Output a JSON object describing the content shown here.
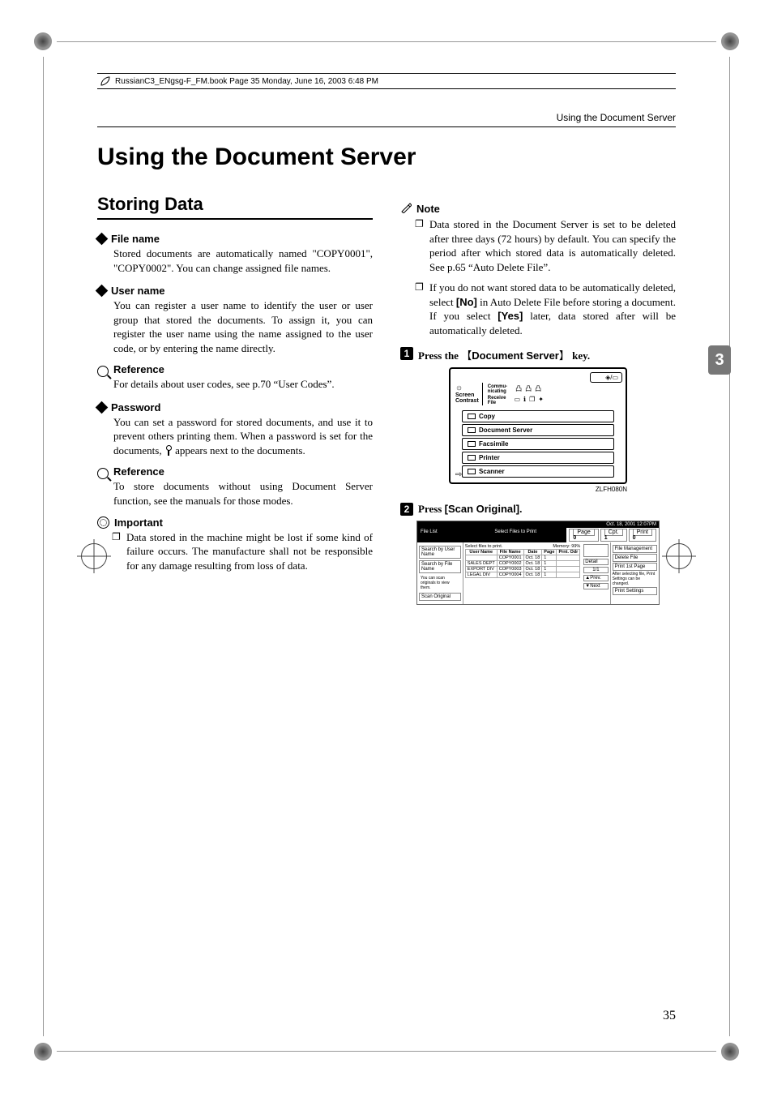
{
  "book_header": "RussianC3_ENgsg-F_FM.book  Page 35  Monday, June 16, 2003  6:48 PM",
  "running_head": "Using the Document Server",
  "title": "Using the Document Server",
  "section_heading": "Storing Data",
  "thumb_tab": "3",
  "page_number": "35",
  "filename": {
    "head": "File name",
    "body": "Stored documents are automatically named \"COPY0001\", \"COPY0002\". You can change assigned file names."
  },
  "username": {
    "head": "User name",
    "body": "You can register a user name to identify the user or user group that stored the documents. To assign it, you can register the user name using the name assigned to the user code, or by entering the name directly."
  },
  "reference1": {
    "head": "Reference",
    "body": "For details about user codes, see p.70 “User Codes”."
  },
  "password": {
    "head": "Password",
    "body_a": "You can set a password for stored documents, and use it to prevent others printing them. When a password is set for the documents, ",
    "body_b": " appears next to the documents."
  },
  "reference2": {
    "head": "Reference",
    "body": "To store documents without using Document Server function, see the manuals for those modes."
  },
  "important": {
    "head": "Important",
    "item": "Data stored in the machine might be lost if some kind of failure occurs. The manufacture shall not be responsible for any damage resulting from loss of data."
  },
  "note": {
    "head": "Note",
    "item1": "Data stored in the Document Server is set to be deleted after three days (72 hours) by default. You can specify the period after which stored data is automatically deleted. See p.65 “Auto Delete File”.",
    "item2_a": "If you do not want stored data to be automatically deleted, select ",
    "item2_no": "[No]",
    "item2_b": " in Auto Delete File before storing a document. If you select ",
    "item2_yes": "[Yes]",
    "item2_c": " later, data stored after will be automatically deleted."
  },
  "step1": {
    "num": "1",
    "pre": "Press the ",
    "key": "Document Server",
    "post": " key."
  },
  "panel": {
    "screen_contrast_a": "Screen",
    "screen_contrast_b": "Contrast",
    "commu": "Commu-\nnicating",
    "receive": "Receive\nFile",
    "menu": [
      "Copy",
      "Document Server",
      "Facsimile",
      "Printer",
      "Scanner"
    ],
    "caption": "ZLFH080N"
  },
  "step2": {
    "num": "2",
    "pre": "Press ",
    "key": "[Scan Original]",
    "post": "."
  },
  "screen": {
    "title_left": "File List",
    "title_center": "Select Files to Print",
    "date": "Oct. 18, 2001   12:07PM",
    "left": [
      "Search by User Name",
      "Search by File Name",
      "",
      "Scan Original"
    ],
    "left_note": "You can scan originals to view them.",
    "th": [
      "User Name",
      "File Name",
      "Date",
      "Page",
      "Prnt. Odr"
    ],
    "rows": [
      [
        "",
        "COPY0001",
        "Oct. 18",
        "1",
        ""
      ],
      [
        "SALES DEPT",
        "COPY0002",
        "Oct. 18",
        "1",
        ""
      ],
      [
        "EXPORT DIV",
        "COPY0003",
        "Oct. 18",
        "1",
        ""
      ],
      [
        "LEGAL DIV",
        "COPY0004",
        "Oct. 18",
        "1",
        ""
      ]
    ],
    "select_hint": "Select files to print.",
    "memory_label": "Memory",
    "memory_val": "99%",
    "counters": [
      "Page",
      "Cpt.",
      "Print"
    ],
    "counter_vals": [
      "0",
      "1",
      "0"
    ],
    "right": [
      "File Management",
      "Delete File",
      "Print 1st Page",
      "",
      "Print Settings"
    ],
    "right_note": "After selecting file, Print Settings can be changed.",
    "nav": [
      "▲Prev.",
      "▼Next"
    ],
    "detail": "Detail",
    "scroll": "1/1"
  }
}
